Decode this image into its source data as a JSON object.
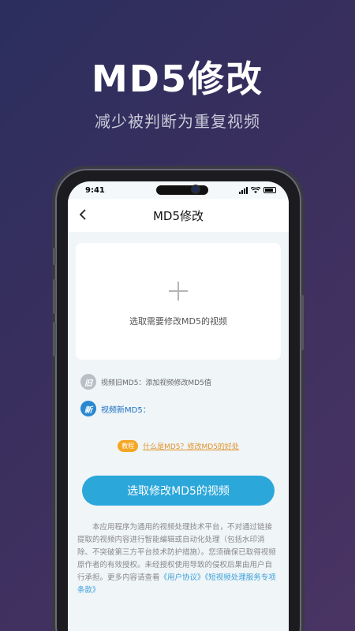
{
  "hero": {
    "title": "MD5修改",
    "subtitle": "减少被判断为重复视频"
  },
  "status": {
    "time": "9:41"
  },
  "nav": {
    "back_icon": "chevron-left-icon",
    "title": "MD5修改"
  },
  "upload": {
    "plus_icon": "plus-icon",
    "text": "选取需要修改MD5的视频"
  },
  "old_md5": {
    "badge": "旧",
    "text": "视频旧MD5：添加视频修改MD5值"
  },
  "new_md5": {
    "badge": "新",
    "text": "视频新MD5："
  },
  "tutorial": {
    "badge": "教程",
    "link": "什么是MD5？修改MD5的好处"
  },
  "action": {
    "button_label": "选取修改MD5的视频"
  },
  "disclaimer": {
    "text": "本应用程序为通用的视频处理技术平台，不对通过链接提取的视频内容进行智能编辑或自动化处理（包括水印消除、不突破第三方平台技术防护措施）。您须确保已取得视频原作者的有效授权。未经授权使用导致的侵权后果由用户自行承担。更多内容请查看",
    "link1": "《用户协议》",
    "link2": "《短视频处理服务专项条款》"
  },
  "colors": {
    "accent": "#2ba7da",
    "tutorial": "#f5a623",
    "new_badge": "#2a88d0"
  }
}
